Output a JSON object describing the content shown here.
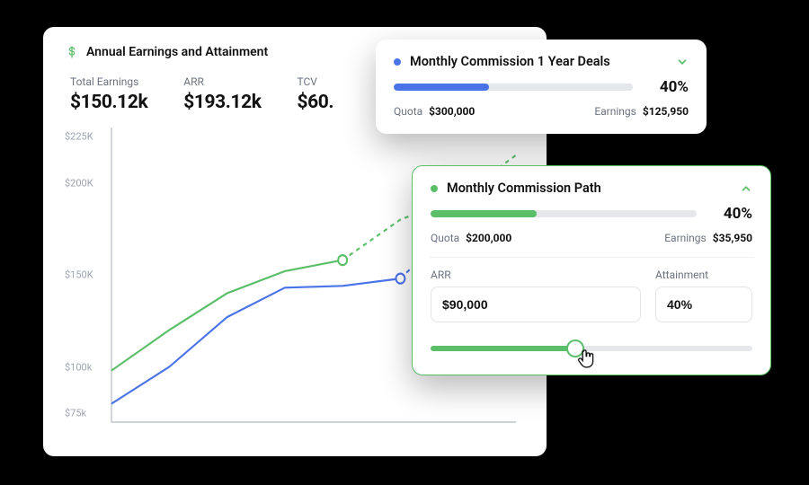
{
  "main": {
    "title": "Annual Earnings and Attainment",
    "kpis": [
      {
        "label": "Total Earnings",
        "value": "$150.12k"
      },
      {
        "label": "ARR",
        "value": "$193.12k"
      },
      {
        "label": "TCV",
        "value": "$60."
      }
    ]
  },
  "chart_data": {
    "type": "line",
    "x": [
      1,
      2,
      3,
      4,
      5,
      6,
      7,
      8
    ],
    "ylim": [
      70,
      230
    ],
    "ylabel": "",
    "ytick_labels": [
      "$75k",
      "$100k",
      "$150K",
      "$200K",
      "$225K"
    ],
    "ytick_values": [
      75,
      100,
      150,
      200,
      225
    ],
    "series": [
      {
        "name": "green actual",
        "color": "#5BBF6A",
        "style": "solid",
        "x": [
          1,
          2,
          3,
          4,
          5
        ],
        "values": [
          98,
          120,
          140,
          152,
          158
        ]
      },
      {
        "name": "green forecast",
        "color": "#5BBF6A",
        "style": "dashed",
        "x": [
          5,
          6,
          7,
          8
        ],
        "values": [
          158,
          180,
          192,
          215
        ]
      },
      {
        "name": "blue actual",
        "color": "#4B73E8",
        "style": "solid",
        "x": [
          1,
          2,
          3,
          4,
          5,
          6
        ],
        "values": [
          80,
          100,
          127,
          143,
          144,
          148
        ]
      },
      {
        "name": "blue forecast",
        "color": "#4B73E8",
        "style": "dashed",
        "x": [
          6,
          7,
          8
        ],
        "values": [
          148,
          178,
          200
        ]
      }
    ],
    "markers": [
      {
        "series": "green actual",
        "x": 5,
        "y": 158
      },
      {
        "series": "blue actual",
        "x": 6,
        "y": 148
      }
    ]
  },
  "card1": {
    "title": "Monthly Commission 1 Year Deals",
    "pct_label": "40%",
    "fill_pct": 40,
    "quota_label": "Quota",
    "quota_value": "$300,000",
    "earnings_label": "Earnings",
    "earnings_value": "$125,950"
  },
  "card2": {
    "title": "Monthly Commission Path",
    "pct_label": "40%",
    "fill_pct": 40,
    "quota_label": "Quota",
    "quota_value": "$200,000",
    "earnings_label": "Earnings",
    "earnings_value": "$35,950",
    "arr_label": "ARR",
    "arr_value": "$90,000",
    "attainment_label": "Attainment",
    "attainment_value": "40%",
    "slider_pct": 45
  }
}
